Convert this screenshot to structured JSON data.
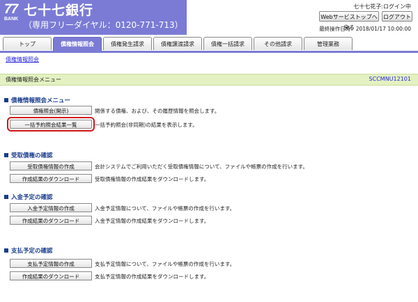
{
  "header": {
    "logo_num": "77",
    "logo_bank": "BANK",
    "bank_name": "七十七銀行",
    "tel": "（専用フリーダイヤル：0120-771-713）",
    "user": "七十七花子:ログイン中",
    "web_service_button": "Webサービストップへ戻る",
    "logout_button": "ログアウト",
    "last_op": "最終操作日時：2018/01/17 10:00:00"
  },
  "tabs": [
    "トップ",
    "債権情報照会",
    "債権発生請求",
    "債権譲渡請求",
    "債権一括請求",
    "その他請求",
    "管理業務"
  ],
  "breadcrumb": "債権情報照会",
  "page": {
    "title": "債権情報照会メニュー",
    "screen_id": "SCCMNU12101"
  },
  "sections": [
    {
      "title": "債権情報照会メニュー",
      "items": [
        {
          "label": "債権照会(開示)",
          "desc": "関係する債権、および、その履歴情報を照会します。"
        },
        {
          "label": "一括予約照会結果一覧",
          "desc": "一括予約照会(非同期)の結果を表示します。"
        }
      ]
    },
    {
      "title": "受取債権の確認",
      "items": [
        {
          "label": "受取債権情報の作成",
          "desc": "会計システムでご利用いただく受取債権情報について、ファイルや帳票の作成を行います。"
        },
        {
          "label": "作成結果のダウンロード",
          "desc": "受取債権情報の作成結果をダウンロードします。"
        }
      ]
    },
    {
      "title": "入金予定の確認",
      "items": [
        {
          "label": "入金予定情報の作成",
          "desc": "入金予定情報について、ファイルや帳票の作成を行います。"
        },
        {
          "label": "作成結果のダウンロード",
          "desc": "入金予定情報の作成結果をダウンロードします。"
        }
      ]
    },
    {
      "title": "支払予定の確認",
      "items": [
        {
          "label": "支払予定情報の作成",
          "desc": "支払予定情報について、ファイルや帳票の作成を行います。"
        },
        {
          "label": "作成結果のダウンロード",
          "desc": "支払予定情報の作成結果をダウンロードします。"
        }
      ]
    }
  ],
  "colors": {
    "brand": "#7b7bd6",
    "highlight": "#d0161a",
    "section": "#1a3c8c",
    "pagebar": "#e4f1c2"
  }
}
